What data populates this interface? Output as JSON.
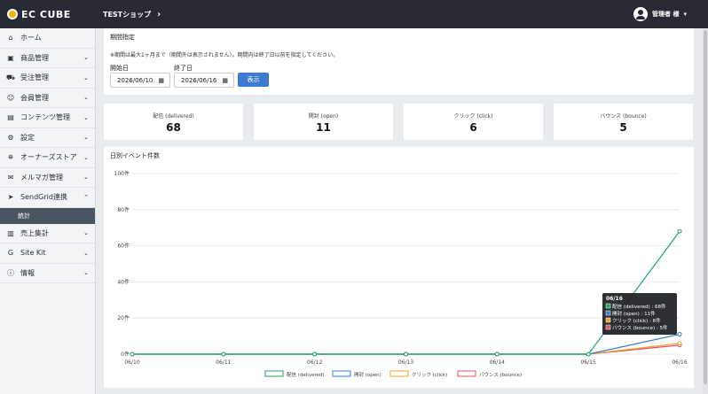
{
  "topbar": {
    "logo": "EC CUBE",
    "shop_name": "TESTショップ",
    "shop_chevron": "›",
    "user_name": "管理者 様",
    "user_caret": "▾"
  },
  "sidebar": {
    "items": [
      {
        "label": "ホーム",
        "icon": "home-icon",
        "glyph": "⌂",
        "has_chevron": false
      },
      {
        "label": "商品管理",
        "icon": "cart-icon",
        "glyph": "▣",
        "has_chevron": true
      },
      {
        "label": "受注管理",
        "icon": "truck-icon",
        "glyph": "⛟",
        "has_chevron": true
      },
      {
        "label": "会員管理",
        "icon": "users-icon",
        "glyph": "☺",
        "has_chevron": true
      },
      {
        "label": "コンテンツ管理",
        "icon": "file-icon",
        "glyph": "▤",
        "has_chevron": true
      },
      {
        "label": "設定",
        "icon": "gear-icon",
        "glyph": "⚙",
        "has_chevron": true
      },
      {
        "label": "オーナーズストア",
        "icon": "store-icon",
        "glyph": "⛯",
        "has_chevron": true
      },
      {
        "label": "メルマガ管理",
        "icon": "mail-icon",
        "glyph": "✉",
        "has_chevron": true
      },
      {
        "label": "SendGrid連携",
        "icon": "send-icon",
        "glyph": "➤",
        "has_chevron": true,
        "expanded": true
      },
      {
        "label": "売上集計",
        "icon": "chart-icon",
        "glyph": "▥",
        "has_chevron": true
      },
      {
        "label": "Site Kit",
        "icon": "google-icon",
        "glyph": "G",
        "has_chevron": true
      },
      {
        "label": "情報",
        "icon": "info-icon",
        "glyph": "ⓘ",
        "has_chevron": true
      }
    ],
    "sub_item": "統計",
    "chevron_down": "⌄",
    "chevron_up": "⌃"
  },
  "period": {
    "title": "期間指定",
    "note": "※期間は最大1ヶ月まで（期間外は表示されません）。期間内は終了日以前を指定してください。",
    "start_label": "開始日",
    "start_value": "2026/06/10",
    "end_label": "終了日",
    "end_value": "2026/06/16",
    "calendar_icon": "▦",
    "show_button": "表示"
  },
  "stats": [
    {
      "label": "配信 (delivered)",
      "value": "68"
    },
    {
      "label": "開封 (open)",
      "value": "11"
    },
    {
      "label": "クリック (click)",
      "value": "6"
    },
    {
      "label": "バウンス (bounce)",
      "value": "5"
    }
  ],
  "chart_title": "日別イベント件数",
  "colors": {
    "delivered": "#1fa463",
    "open": "#3b7bd0",
    "click": "#f0a030",
    "bounce": "#e05060",
    "grid": "#e3e5e8"
  },
  "chart_data": {
    "type": "line",
    "title": "日別イベント件数",
    "categories": [
      "06/10",
      "06/11",
      "06/12",
      "06/13",
      "06/14",
      "06/15",
      "06/16"
    ],
    "y_ticks": [
      "0件",
      "20件",
      "40件",
      "60件",
      "80件",
      "100件"
    ],
    "ylim": [
      0,
      100
    ],
    "grid": true,
    "legend_placement": "bottom",
    "series": [
      {
        "name": "配信 (delivered)",
        "values": [
          0,
          0,
          0,
          0,
          0,
          0,
          68
        ]
      },
      {
        "name": "開封 (open)",
        "values": [
          0,
          0,
          0,
          0,
          0,
          0,
          11
        ]
      },
      {
        "name": "クリック (click)",
        "values": [
          0,
          0,
          0,
          0,
          0,
          0,
          6
        ]
      },
      {
        "name": "バウンス (bounce)",
        "values": [
          0,
          0,
          0,
          0,
          0,
          0,
          5
        ]
      }
    ],
    "tooltip": {
      "title": "06/16",
      "lines": [
        "配信 (delivered) : 68件",
        "開封 (open) : 11件",
        "クリック (click) : 6件",
        "バウンス (bounce) : 5件"
      ]
    }
  }
}
